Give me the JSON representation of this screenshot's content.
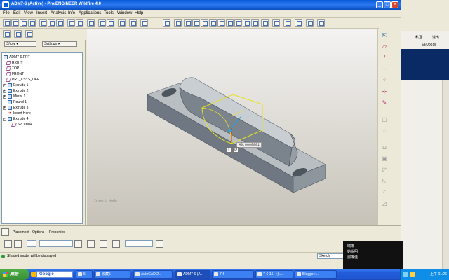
{
  "window": {
    "title": "ADM7-6 (Active) - Pro/ENGINEER Wildfire 4.0"
  },
  "menu": [
    "File",
    "Edit",
    "View",
    "Insert",
    "Analysis",
    "Info",
    "Applications",
    "Tools",
    "Window",
    "Help"
  ],
  "left_panel": {
    "show_label": "Show ▾",
    "settings_label": "Settings ▾",
    "tree": [
      {
        "label": "ADM7-6.PRT",
        "kind": "part"
      },
      {
        "label": "RIGHT",
        "kind": "plane"
      },
      {
        "label": "TOP",
        "kind": "plane"
      },
      {
        "label": "FRONT",
        "kind": "plane"
      },
      {
        "label": "PRT_CSYS_DEF",
        "kind": "csys"
      },
      {
        "label": "Extrude 1",
        "kind": "feat"
      },
      {
        "label": "Extrude 2",
        "kind": "feat"
      },
      {
        "label": "Mirror 1",
        "kind": "feat"
      },
      {
        "label": "Round 1",
        "kind": "feat"
      },
      {
        "label": "Extrude 3",
        "kind": "feat"
      },
      {
        "label": "Insert Here",
        "kind": "insert"
      },
      {
        "label": "Extrude 4",
        "kind": "feat"
      },
      {
        "label": "S2D0004",
        "kind": "sketch"
      }
    ]
  },
  "viewport": {
    "mode_label": "Insert Mode",
    "dim_tag": "40.0000001",
    "mini_buttons": [
      "T",
      "D"
    ]
  },
  "dashboard": {
    "tabs": [
      "Placement",
      "Options",
      "Properties"
    ]
  },
  "status": {
    "message": "Shaded model will be displayed",
    "sketch_box": "Sketch"
  },
  "side_app": {
    "top_labels": [
      "私互",
      "退出"
    ],
    "id_label": "id:U0015"
  },
  "popup": {
    "lines": [
      "瑞琳",
      "她說明",
      "謝琳佳"
    ]
  },
  "taskbar": {
    "start_label": "開始",
    "search_label": "Google",
    "tasks": [
      {
        "label": "5",
        "active": false
      },
      {
        "label": "收藏5",
        "active": false
      },
      {
        "label": "AutoCAD 2...",
        "active": false
      },
      {
        "label": "ADM7-6 (A...",
        "active": true
      },
      {
        "label": "7-6",
        "active": false
      },
      {
        "label": "7-6-15 - 小...",
        "active": false
      },
      {
        "label": "Blogger: ...",
        "active": false
      }
    ],
    "clock": "上午 01:26"
  }
}
